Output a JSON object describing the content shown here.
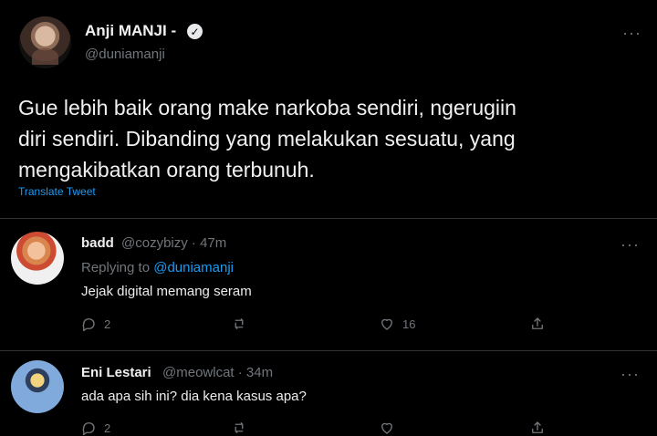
{
  "tweet": {
    "author_name": "Anji MANJI -",
    "author_handle": "@duniamanji",
    "verified_mark": "✓",
    "more_label": "···",
    "text_line1": "Gue lebih baik orang make narkoba sendiri, ngerugiin",
    "text_line2": "diri sendiri. Dibanding yang melakukan sesuatu, yang",
    "text_line3": "mengakibatkan orang terbunuh.",
    "translate_label": "Translate Tweet"
  },
  "replies": [
    {
      "name": "badd",
      "handle_time": "@cozybizy · 47m",
      "replying_prefix": "Replying to",
      "replying_to": "@duniamanji",
      "text": "Jejak digital memang seram",
      "reply_count": "2",
      "like_count": "16",
      "more_label": "···"
    },
    {
      "name": "Eni Lestari",
      "handle_time": "@meowlcat · 34m",
      "text": "ada apa sih ini? dia kena kasus apa?",
      "reply_count": "2",
      "more_label": "···"
    }
  ],
  "colors": {
    "background": "#000000",
    "text": "#e7e9ea",
    "muted": "#71767b",
    "link": "#1d9bf0",
    "divider": "#2f3336"
  },
  "icons": {
    "verified": "verified-badge-icon",
    "more": "more-options-icon",
    "reply": "reply-icon",
    "retweet": "retweet-icon",
    "like": "heart-icon",
    "share": "share-icon"
  }
}
